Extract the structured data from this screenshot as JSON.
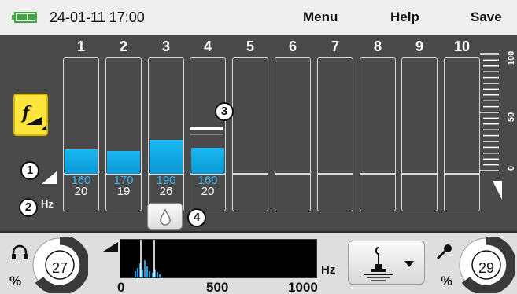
{
  "status": {
    "datetime": "24-01-11 17:00",
    "battery_icon": "battery-full-icon",
    "battery_level": 1.0,
    "battery_color": "#3aa83a"
  },
  "menu": {
    "menu_label": "Menu",
    "help_label": "Help",
    "save_label": "Save"
  },
  "channels": [
    {
      "num": "1",
      "freq": "160",
      "gain": "20",
      "level": 0.16
    },
    {
      "num": "2",
      "freq": "170",
      "gain": "19",
      "level": 0.15
    },
    {
      "num": "3",
      "freq": "190",
      "gain": "26",
      "level": 0.22
    },
    {
      "num": "4",
      "freq": "160",
      "gain": "20",
      "level": 0.17
    },
    {
      "num": "5",
      "freq": "",
      "gain": "",
      "level": 0
    },
    {
      "num": "6",
      "freq": "",
      "gain": "",
      "level": 0
    },
    {
      "num": "7",
      "freq": "",
      "gain": "",
      "level": 0
    },
    {
      "num": "8",
      "freq": "",
      "gain": "",
      "level": 0
    },
    {
      "num": "9",
      "freq": "",
      "gain": "",
      "level": 0
    },
    {
      "num": "10",
      "freq": "",
      "gain": "",
      "level": 0
    }
  ],
  "labels": {
    "hz": "Hz"
  },
  "callouts": {
    "c1": "1",
    "c2": "2",
    "c3": "3",
    "c4": "4"
  },
  "scale": {
    "top": "100",
    "mid": "50",
    "bottom": "0"
  },
  "left_gauge": {
    "value": "27",
    "unit": "%",
    "icon": "headphones-icon"
  },
  "right_gauge": {
    "value": "29",
    "unit": "%",
    "icon": "microphone-icon"
  },
  "spectrum": {
    "unit": "Hz",
    "axis_min": "0",
    "axis_mid": "500",
    "axis_max": "1000"
  },
  "colors": {
    "fill": "#1ab8f2",
    "panel": "#4a4a4a",
    "filter_button": "#ffe53b"
  }
}
